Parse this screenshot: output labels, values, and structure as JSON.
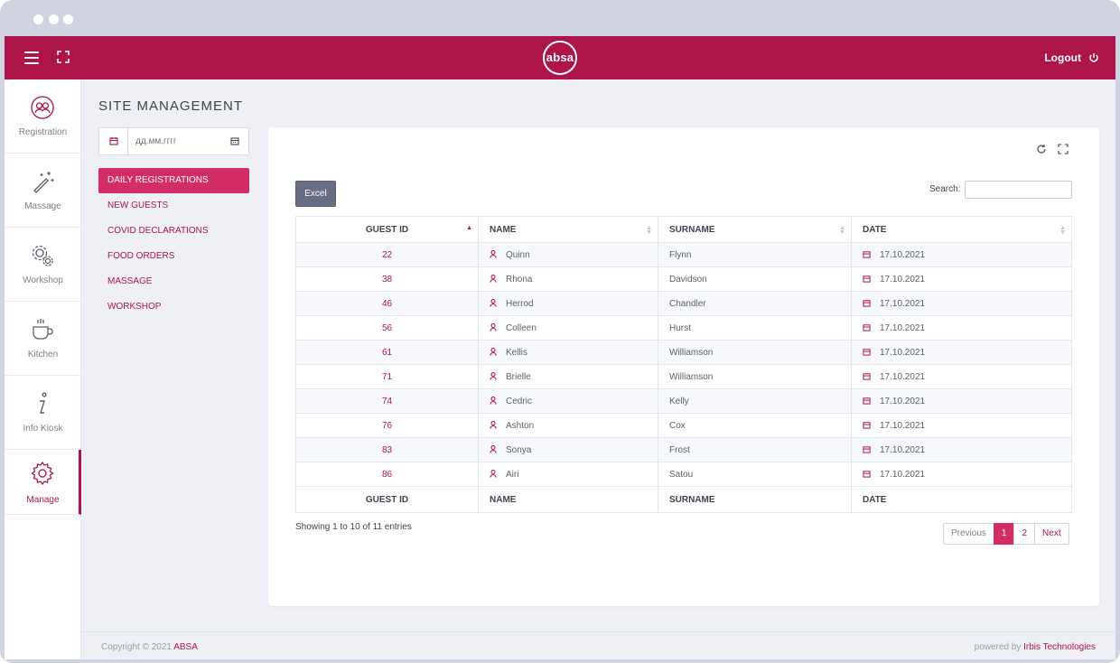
{
  "brand": {
    "logo_text": "absa",
    "accent": "#ad1449",
    "accent_light": "#d22d66"
  },
  "topbar": {
    "logout_label": "Logout"
  },
  "sidebar": {
    "items": [
      {
        "label": "Registration",
        "icon": "registration-icon"
      },
      {
        "label": "Massage",
        "icon": "magic-wand-icon"
      },
      {
        "label": "Workshop",
        "icon": "gears-icon"
      },
      {
        "label": "Kitchen",
        "icon": "coffee-cup-icon"
      },
      {
        "label": "Info Kiosk",
        "icon": "info-icon"
      },
      {
        "label": "Manage",
        "icon": "gear-icon",
        "active": true
      }
    ]
  },
  "page": {
    "title": "SITE MANAGEMENT",
    "date_placeholder": "дд.мм.гггг"
  },
  "menu": {
    "items": [
      "DAILY REGISTRATIONS",
      "NEW GUESTS",
      "COVID DECLARATIONS",
      "FOOD ORDERS",
      "MASSAGE",
      "WORKSHOP"
    ],
    "active": "DAILY REGISTRATIONS"
  },
  "toolbar": {
    "excel_label": "Excel",
    "search_label": "Search:"
  },
  "table": {
    "columns": [
      "GUEST ID",
      "NAME",
      "SURNAME",
      "DATE"
    ],
    "rows": [
      {
        "id": "22",
        "name": "Quinn",
        "surname": "Flynn",
        "date": "17.10.2021"
      },
      {
        "id": "38",
        "name": "Rhona",
        "surname": "Davidson",
        "date": "17.10.2021"
      },
      {
        "id": "46",
        "name": "Herrod",
        "surname": "Chandler",
        "date": "17.10.2021"
      },
      {
        "id": "56",
        "name": "Colleen",
        "surname": "Hurst",
        "date": "17.10.2021"
      },
      {
        "id": "61",
        "name": "Kellis",
        "surname": "Williamson",
        "date": "17.10.2021"
      },
      {
        "id": "71",
        "name": "Brielle",
        "surname": "Williamson",
        "date": "17.10.2021"
      },
      {
        "id": "74",
        "name": "Cedric",
        "surname": "Kelly",
        "date": "17.10.2021"
      },
      {
        "id": "76",
        "name": "Ashton",
        "surname": "Cox",
        "date": "17.10.2021"
      },
      {
        "id": "83",
        "name": "Sonya",
        "surname": "Frost",
        "date": "17.10.2021"
      },
      {
        "id": "86",
        "name": "Airi",
        "surname": "Satou",
        "date": "17.10.2021"
      }
    ]
  },
  "pagination": {
    "info": "Showing 1 to 10 of 11 entries",
    "previous": "Previous",
    "pages": [
      "1",
      "2"
    ],
    "current": "1",
    "next": "Next"
  },
  "footer": {
    "copyright_prefix": "Copyright © 2021",
    "copyright_brand": "ABSA",
    "powered_prefix": "powered by",
    "powered_brand": "Irbis Technologies"
  }
}
